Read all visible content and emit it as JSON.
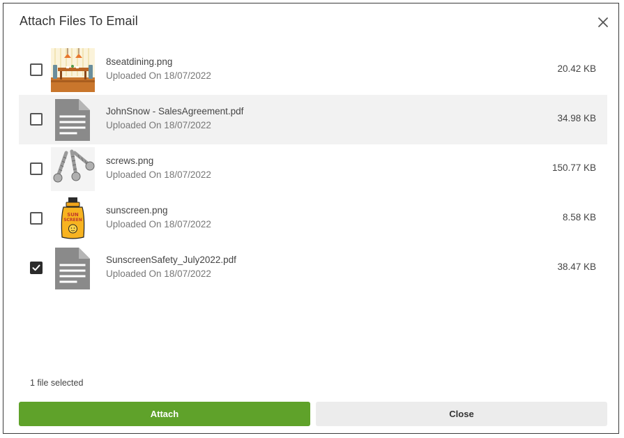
{
  "dialog": {
    "title": "Attach Files To Email",
    "close_icon": "close-icon"
  },
  "files": [
    {
      "name": "8seatdining.png",
      "uploaded": "Uploaded On 18/07/2022",
      "size": "20.42 KB",
      "checked": false,
      "thumb": "dining-room-image"
    },
    {
      "name": "JohnSnow - SalesAgreement.pdf",
      "uploaded": "Uploaded On 18/07/2022",
      "size": "34.98 KB",
      "checked": false,
      "thumb": "document-icon"
    },
    {
      "name": "screws.png",
      "uploaded": "Uploaded On 18/07/2022",
      "size": "150.77 KB",
      "checked": false,
      "thumb": "screws-image"
    },
    {
      "name": "sunscreen.png",
      "uploaded": "Uploaded On 18/07/2022",
      "size": "8.58 KB",
      "checked": false,
      "thumb": "sunscreen-image"
    },
    {
      "name": "SunscreenSafety_July2022.pdf",
      "uploaded": "Uploaded On 18/07/2022",
      "size": "38.47 KB",
      "checked": true,
      "thumb": "document-icon"
    }
  ],
  "footer": {
    "selection_status": "1 file selected",
    "attach_label": "Attach",
    "close_label": "Close"
  },
  "colors": {
    "attach_button": "#5fa22a",
    "close_button": "#ececec",
    "row_highlight": "#f2f2f2",
    "checkbox_checked": "#2b2b2b"
  },
  "thumb_text": {
    "sunscreen_label_line1": "SUN",
    "sunscreen_label_line2": "SCREEN"
  }
}
